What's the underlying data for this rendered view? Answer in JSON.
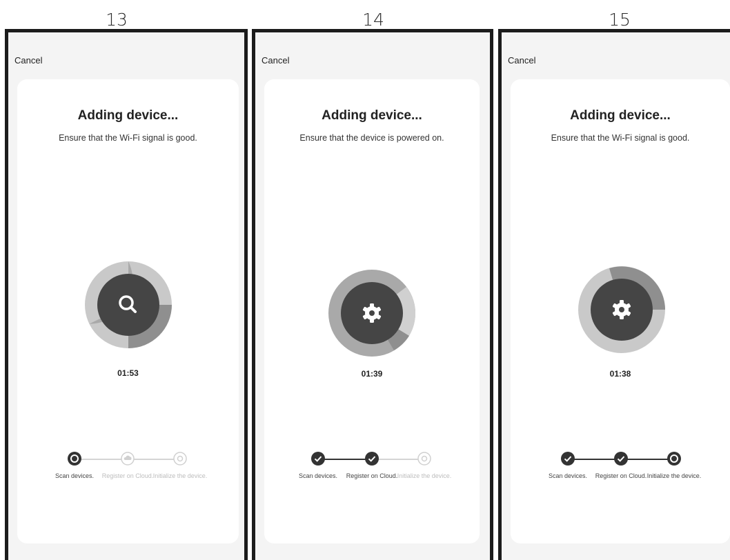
{
  "screens": [
    {
      "number": "13",
      "cancel_label": "Cancel",
      "title": "Adding device...",
      "subtitle": "Ensure that the Wi-Fi signal is good.",
      "timer": "01:53",
      "center_icon": "search-icon",
      "steps": [
        {
          "label": "Scan devices.",
          "state": "active"
        },
        {
          "label": "Register on Cloud.",
          "state": "pending"
        },
        {
          "label": "Initialize the device.",
          "state": "pending"
        }
      ]
    },
    {
      "number": "14",
      "cancel_label": "Cancel",
      "title": "Adding device...",
      "subtitle": "Ensure that the device is powered on.",
      "timer": "01:39",
      "center_icon": "gear-icon",
      "steps": [
        {
          "label": "Scan devices.",
          "state": "done"
        },
        {
          "label": "Register on Cloud.",
          "state": "done"
        },
        {
          "label": "Initialize the device.",
          "state": "pending"
        }
      ]
    },
    {
      "number": "15",
      "cancel_label": "Cancel",
      "title": "Adding device...",
      "subtitle": "Ensure that the Wi-Fi signal is good.",
      "timer": "01:38",
      "center_icon": "gear-icon",
      "steps": [
        {
          "label": "Scan devices.",
          "state": "done"
        },
        {
          "label": "Register on Cloud.",
          "state": "done"
        },
        {
          "label": "Initialize the device.",
          "state": "active"
        }
      ]
    }
  ],
  "colors": {
    "panel_background": "#f4f4f4",
    "card_background": "#ffffff",
    "ring_light": "#c9c9c9",
    "ring_mid": "#a9a9a9",
    "ring_dark": "#8f8f8f",
    "center_dark": "#454545",
    "step_done": "#333333",
    "step_pending": "#c8c8c8"
  }
}
